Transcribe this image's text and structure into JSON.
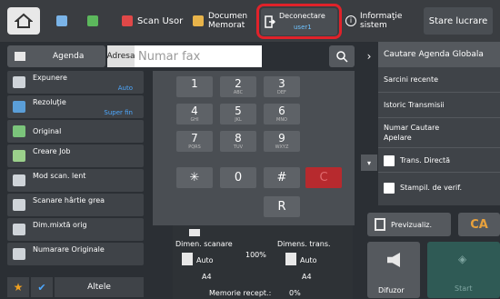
{
  "topbar": {
    "scan_usor": "Scan Usor",
    "document_memorat": "Documen Memorat",
    "deconectare": "Deconectare",
    "user": "user1",
    "informatie": "Informaţie sistem",
    "stare": "Stare lucrare"
  },
  "address": {
    "agenda": "Agenda",
    "adresa": "Adresa",
    "placeholder": "Numar fax"
  },
  "settings": [
    {
      "name": "Expunere",
      "value": "Auto"
    },
    {
      "name": "Rezoluţie",
      "value": "Super fin"
    },
    {
      "name": "Original",
      "value": ""
    },
    {
      "name": "Creare Job",
      "value": ""
    },
    {
      "name": "Mod scan. lent",
      "value": ""
    },
    {
      "name": "Scanare hârtie grea",
      "value": ""
    },
    {
      "name": "Dim.mixtă orig",
      "value": ""
    },
    {
      "name": "Numarare Originale",
      "value": ""
    }
  ],
  "bottom_left": {
    "altele": "Altele"
  },
  "keypad": [
    {
      "n": "1",
      "s": ""
    },
    {
      "n": "2",
      "s": "ABC"
    },
    {
      "n": "3",
      "s": "DEF"
    },
    {
      "n": "4",
      "s": "GHI"
    },
    {
      "n": "5",
      "s": "JKL"
    },
    {
      "n": "6",
      "s": "MNO"
    },
    {
      "n": "7",
      "s": "PQRS"
    },
    {
      "n": "8",
      "s": "TUV"
    },
    {
      "n": "9",
      "s": "WXYZ"
    },
    {
      "n": "✳",
      "s": ""
    },
    {
      "n": "0",
      "s": ""
    },
    {
      "n": "#",
      "s": ""
    },
    {
      "n": "C",
      "s": ""
    },
    {
      "n": "R",
      "s": ""
    }
  ],
  "status": {
    "dim_scanare": "Dimen. scanare",
    "dim_trans": "Dimens. trans.",
    "auto1": "Auto",
    "a4_1": "A4",
    "zoom": "100%",
    "auto2": "Auto",
    "a4_2": "A4",
    "memorie": "Memorie recept.:",
    "memorie_val": "0%"
  },
  "right_panel": {
    "cautare": "Cautare Agenda Globala",
    "sarcini": "Sarcini recente",
    "istoric": "Istoric Transmisii",
    "numar_cautare": "Numar Cautare Apelare",
    "trans_directa": "Trans. Directă",
    "stampil": "Stampil. de verif."
  },
  "actions": {
    "previzualiz": "Previzualiz.",
    "ca": "CA",
    "difuzor": "Difuzor",
    "start": "Start"
  }
}
